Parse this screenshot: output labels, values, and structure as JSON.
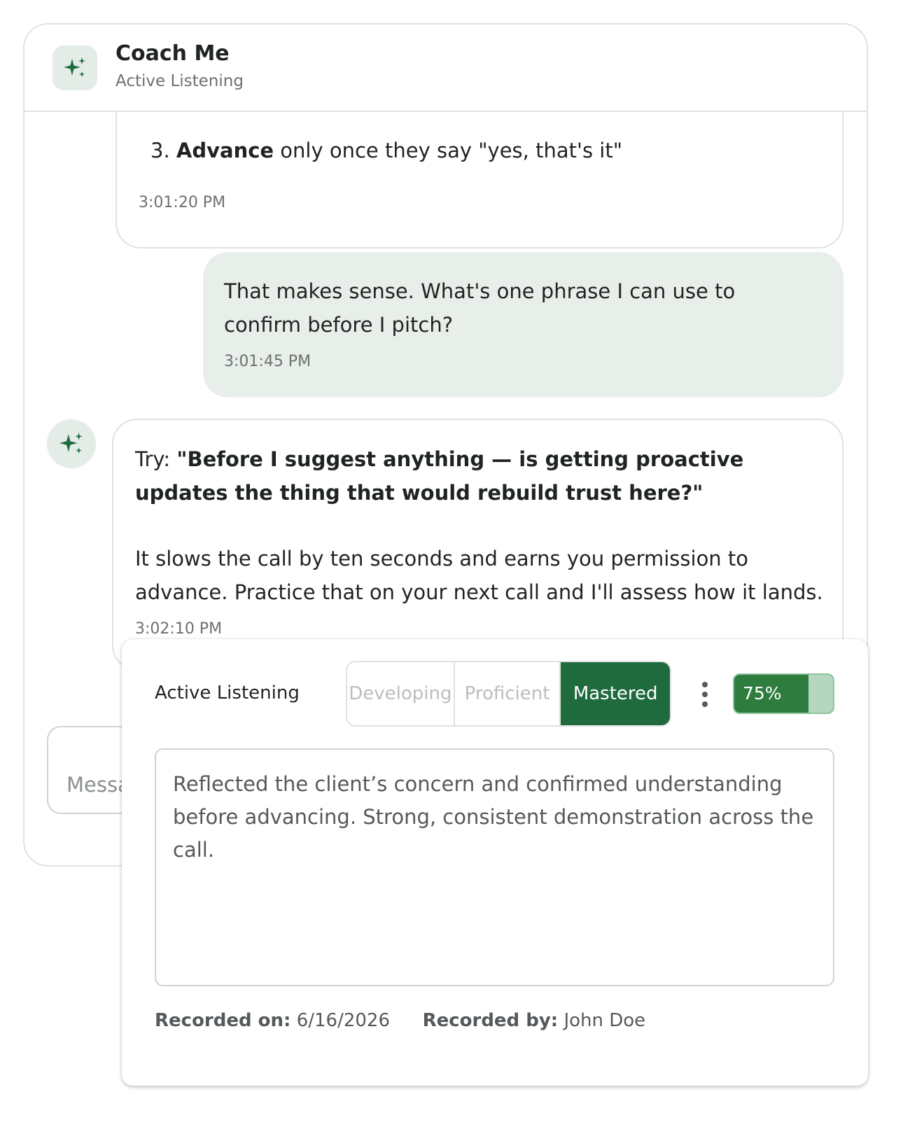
{
  "header": {
    "title": "Coach Me",
    "subtitle": "Active Listening"
  },
  "messages": {
    "ai_previous": {
      "list_number": "3.",
      "bold": "Advance",
      "rest": " only once they say \"yes, that's it\"",
      "time": "3:01:20 PM"
    },
    "user": {
      "text": "That makes sense. What's one phrase I can use to confirm before I pitch?",
      "time": "3:01:45 PM"
    },
    "ai_latest": {
      "prefix": "Try: ",
      "quote": "\"Before I suggest anything — is getting proactive updates the thing that would rebuild trust here?\"",
      "body": "It slows the call by ten seconds and earns you permission to advance. Practice that on your next call and I'll assess how it lands.",
      "time": "3:02:10 PM"
    }
  },
  "composer": {
    "placeholder": "Message"
  },
  "assessment": {
    "skill": "Active Listening",
    "levels": [
      "Developing",
      "Proficient",
      "Mastered"
    ],
    "selected_level": "Mastered",
    "progress_percent": 75,
    "progress_label": "75%",
    "notes": "Reflected the client’s concern and confirmed understanding before advancing. Strong, consistent demonstration across the call.",
    "recorded_on_label": "Recorded on:",
    "recorded_on": "6/16/2026",
    "recorded_by_label": "Recorded by:",
    "recorded_by": "John Doe"
  },
  "colors": {
    "brand_green": "#1f6b3d",
    "progress_fill": "#2e7d3e",
    "progress_track": "#b5d6bf",
    "user_bubble": "#e8eeea",
    "icon_tile": "#e3ece6"
  },
  "icons": {
    "logo": "sparkles-icon",
    "ai_avatar": "sparkles-icon",
    "menu": "more-vertical-icon"
  }
}
